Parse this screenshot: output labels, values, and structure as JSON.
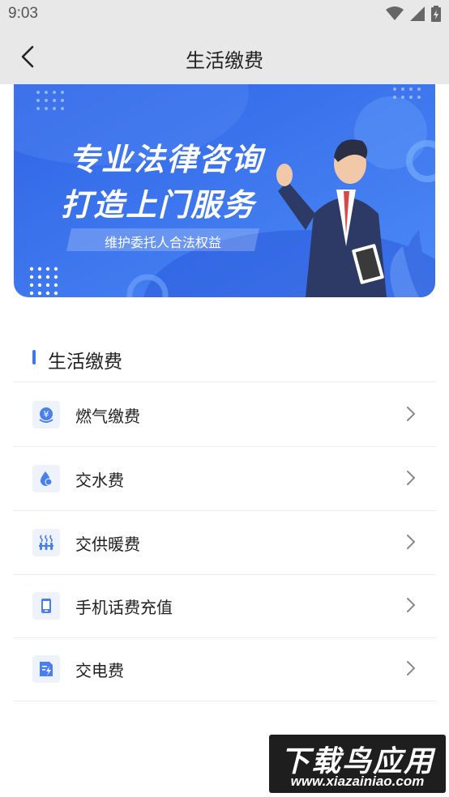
{
  "status_bar": {
    "time": "9:03",
    "icons": [
      "wifi-icon",
      "signal-icon",
      "battery-icon"
    ]
  },
  "app_bar": {
    "back_icon": "chevron-left-icon",
    "title": "生活缴费"
  },
  "banner": {
    "headline_1": "专业法律咨询",
    "headline_2": "打造上门服务",
    "subtitle": "维护委托人合法权益",
    "colors": {
      "bg_start": "#2f63e6",
      "bg_end": "#4a86f5"
    }
  },
  "section": {
    "title": "生活缴费",
    "accent_color": "#3b78f0"
  },
  "items": [
    {
      "label": "燃气缴费",
      "icon": "gas-payment-icon"
    },
    {
      "label": "交水费",
      "icon": "water-drop-icon"
    },
    {
      "label": "交供暖费",
      "icon": "heating-icon"
    },
    {
      "label": "手机话费充值",
      "icon": "mobile-phone-icon"
    },
    {
      "label": "交电费",
      "icon": "electricity-icon"
    }
  ],
  "watermark": {
    "text": "下载鸟应用",
    "url": "www.xiazainiao.com"
  }
}
